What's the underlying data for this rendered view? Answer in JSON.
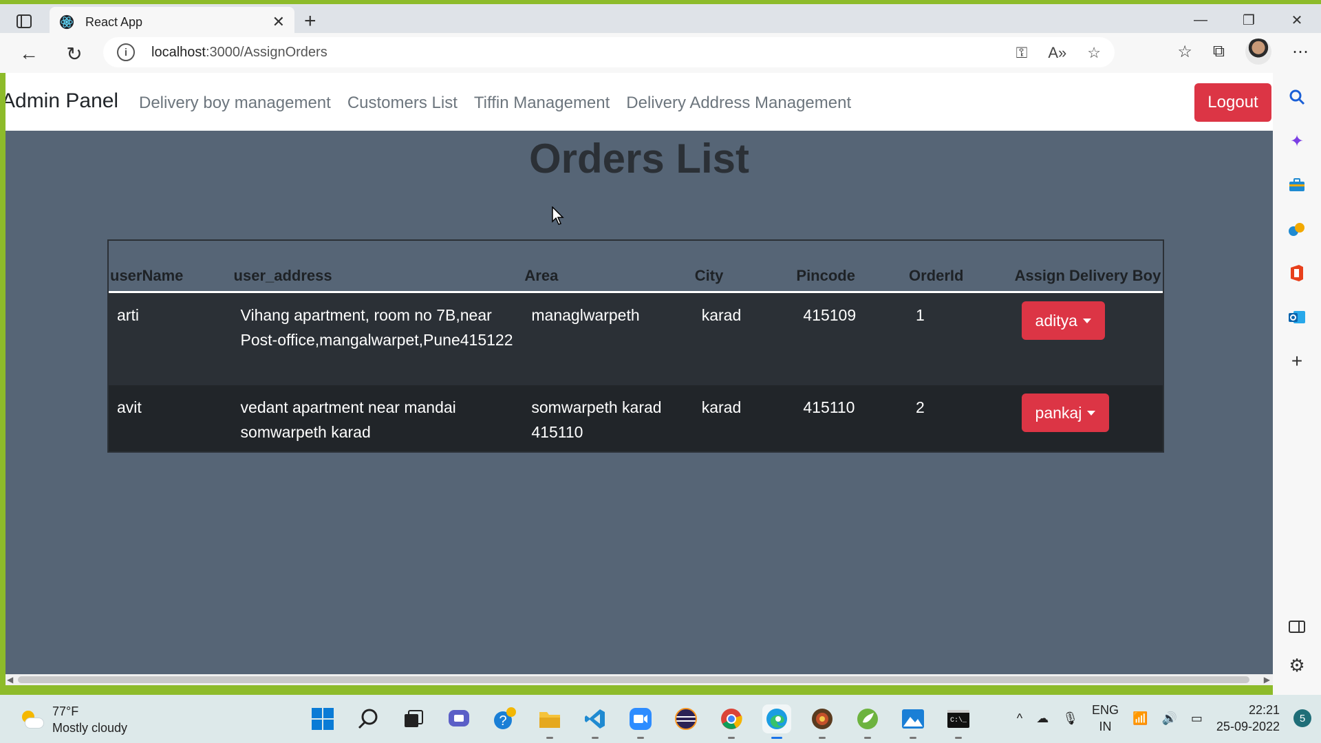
{
  "browser": {
    "tab_title": "React App",
    "url_host": "localhost",
    "url_rest": ":3000/AssignOrders"
  },
  "navbar": {
    "brand": "Admin Panel",
    "links": [
      "Delivery boy management",
      "Customers List",
      "Tiffin Management",
      "Delivery Address Management"
    ],
    "logout_label": "Logout"
  },
  "page": {
    "title": "Orders List"
  },
  "table": {
    "headers": [
      "userName",
      "user_address",
      "Area",
      "City",
      "Pincode",
      "OrderId",
      "Assign Delivery Boy"
    ],
    "rows": [
      {
        "userName": "arti",
        "user_address": "Vihang apartment, room no 7B,near Post-office,mangalwarpet,Pune415122",
        "area": "managlwarpeth",
        "city": "karad",
        "pincode": "415109",
        "orderId": "1",
        "assigned": "aditya"
      },
      {
        "userName": "avit",
        "user_address": "vedant apartment near mandai somwarpeth karad",
        "area": "somwarpeth karad 415110",
        "city": "karad",
        "pincode": "415110",
        "orderId": "2",
        "assigned": "pankaj"
      }
    ]
  },
  "taskbar": {
    "weather_temp": "77°F",
    "weather_desc": "Mostly cloudy",
    "lang_line1": "ENG",
    "lang_line2": "IN",
    "time": "22:21",
    "date": "25-09-2022",
    "notification_count": "5"
  },
  "colors": {
    "accent_red": "#dc3545",
    "page_bg": "#566576",
    "table_dark": "#212529"
  }
}
